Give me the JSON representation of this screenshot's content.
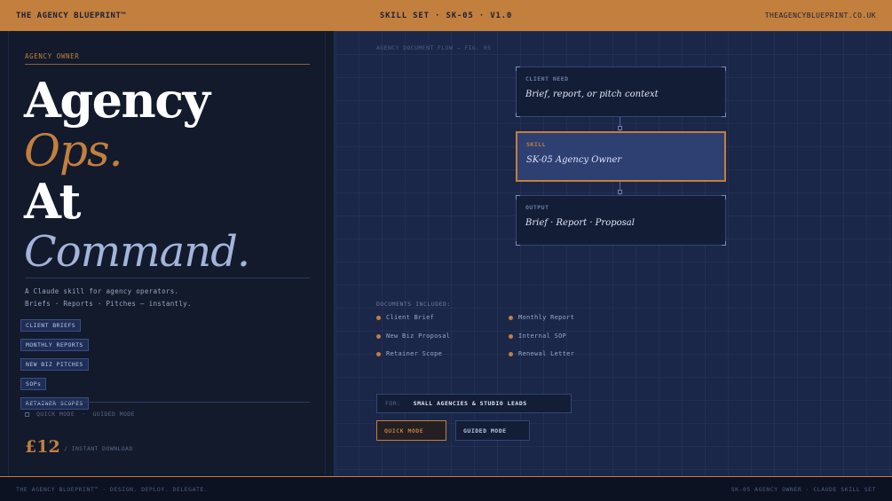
{
  "topbar": {
    "brand": "THE AGENCY BLUEPRINT™",
    "center": "SKILL SET  ·  SK-05  ·  V1.0",
    "site": "THEAGENCYBLUEPRINT.CO.UK"
  },
  "hero": {
    "eyebrow": "AGENCY OWNER",
    "line1": "Agency",
    "line2": "Ops.",
    "line3": "At",
    "line4": "Command.",
    "tagline1": "A Claude skill for agency operators.",
    "tagline2": "Briefs · Reports · Pitches — instantly."
  },
  "chips": [
    "CLIENT BRIEFS",
    "MONTHLY REPORTS",
    "NEW BIZ PITCHES",
    "SOPs",
    "RETAINER SCOPES"
  ],
  "left_modes": {
    "quick": "QUICK MODE",
    "sep": "·",
    "guided": "GUIDED MODE"
  },
  "pricing": {
    "price": "£12",
    "note": "/ INSTANT DOWNLOAD"
  },
  "flow": {
    "fig_label": "AGENCY DOCUMENT FLOW  —  FIG. 05",
    "boxes": [
      {
        "label": "CLIENT NEED",
        "value": "Brief, report, or pitch context"
      },
      {
        "label": "SKILL",
        "value": "SK-05 Agency Owner"
      },
      {
        "label": "OUTPUT",
        "value": "Brief · Report · Proposal"
      }
    ]
  },
  "documents": {
    "title": "DOCUMENTS INCLUDED:",
    "items": [
      "Client Brief",
      "Monthly Report",
      "New Biz Proposal",
      "Internal SOP",
      "Retainer Scope",
      "Renewal Letter"
    ]
  },
  "audience": {
    "key": "FOR:",
    "value": "SMALL AGENCIES & STUDIO LEADS"
  },
  "buttons": {
    "quick": "QUICK MODE",
    "guided": "GUIDED MODE"
  },
  "bottombar": {
    "left": "THE AGENCY BLUEPRINT™  ·  DESIGN. DEPLOY. DELEGATE.",
    "right": "SK-05 AGENCY OWNER  ·  CLAUDE SKILL SET"
  },
  "colors": {
    "accent": "#c27f3e",
    "panel_dark": "#121a2c",
    "panel_blue": "#1b2748",
    "highlight_blue": "#2e3f72"
  }
}
